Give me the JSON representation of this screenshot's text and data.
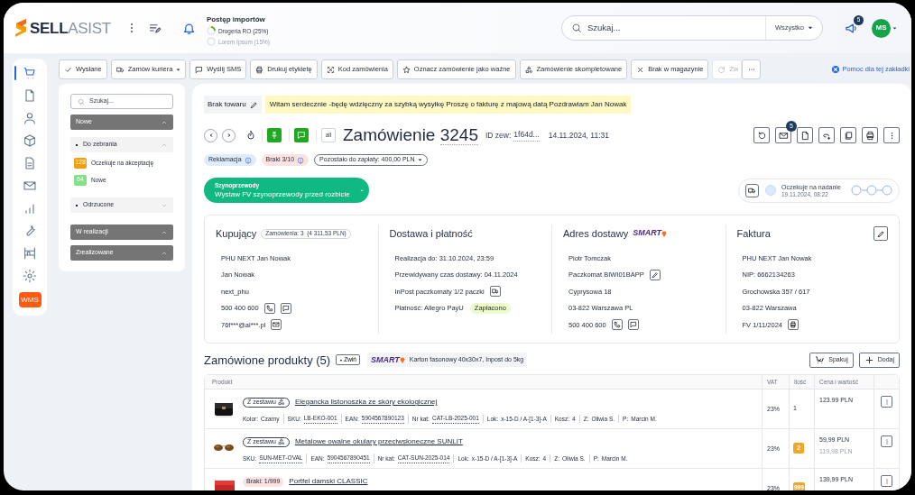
{
  "header": {
    "logo": {
      "bold": "SELL",
      "light": "ASIST"
    },
    "imports": {
      "title": "Postęp importów",
      "items": [
        {
          "label": "Drogeria RO (25%)",
          "level": 0.25,
          "faded": false
        },
        {
          "label": "Lorem Ipsum (15%)",
          "faded": true
        }
      ]
    },
    "search": {
      "placeholder": "Szukaj...",
      "scope": "Wszystko"
    },
    "notifications": "5",
    "avatar": "MS"
  },
  "nav": {
    "items": [
      {
        "selected": true
      },
      {
        "selected": false
      },
      {
        "selected": false
      },
      {
        "selected": false
      },
      {
        "selected": false
      },
      {
        "selected": false
      },
      {
        "selected": false
      },
      {
        "selected": false
      },
      {
        "selected": false
      },
      {
        "selected": false
      }
    ],
    "wms_button": "WMS"
  },
  "toolbar": {
    "actions": [
      {
        "label": "Wysłane",
        "dropdown": false,
        "disabled": false
      },
      {
        "label": "Zamów kuriera",
        "dropdown": true,
        "disabled": false
      },
      {
        "label": "Wyślij SMS",
        "dropdown": false,
        "disabled": false
      },
      {
        "label": "Drukuj etykietę",
        "dropdown": false,
        "disabled": false
      },
      {
        "label": "Kod zamówienia",
        "dropdown": false,
        "disabled": false
      },
      {
        "label": "Oznacz zamówienie jako ważne",
        "dropdown": false,
        "disabled": false
      },
      {
        "label": "Zamówienie skompletowane",
        "dropdown": false,
        "disabled": false
      },
      {
        "label": "Brak w magazynie",
        "dropdown": false,
        "disabled": false
      },
      {
        "label": "Zw",
        "dropdown": false,
        "disabled": true
      }
    ],
    "help_link": "Pomoc dla tej zakładki"
  },
  "filter": {
    "search_placeholder": "Szukaj...",
    "groups": [
      {
        "label": "Nowe",
        "expanded": true,
        "children": [
          {
            "label": "Do zebrania",
            "expanded": true,
            "statuses": [
              {
                "count": "128",
                "label": "Oczekuje na akceptację",
                "color": "#f59e0b"
              },
              {
                "count": "64",
                "label": "Nowe",
                "color": "#86e08a"
              }
            ]
          },
          {
            "label": "Odrzucone",
            "expanded": false
          }
        ]
      },
      {
        "label": "W realizacji",
        "expanded": true
      },
      {
        "label": "Zrealizowane",
        "expanded": true
      }
    ]
  },
  "order": {
    "status_tag": "Brak towaru",
    "note": "Witam serdecznie -będę wdzięczny za szybką wysyłkę Proszę o fakturę z majową datą Pozdrawiam Jan Nowak",
    "pinned": true,
    "has_chat": true,
    "channel": "all",
    "title": "Zamówienie",
    "number": "3245",
    "external_id_label": "ID zew:",
    "external_id": "1f64d...",
    "date": "14.11.2024, 11:31",
    "messages_count": "5",
    "badges": [
      {
        "label": "Reklamacja",
        "kind": "claim"
      },
      {
        "label": "Braki 3/10",
        "kind": "shortage"
      },
      {
        "label": "Pozostało do zapłaty: 400,00 PLN",
        "kind": "payment"
      }
    ],
    "action": {
      "caption": "Szynoprzewody",
      "label": "Wystaw FV szynoprzewody przed rozbicie"
    },
    "shipment": {
      "status": "Oczekuje na nadanie",
      "date": "19.11.2024, 08:22",
      "steps": [
        {
          "done": false
        },
        {
          "done": false
        },
        {
          "done": false
        }
      ]
    }
  },
  "details": [
    {
      "title": "Kupujący",
      "badge": "Zamówienia: 3  (4 311,53 PLN)",
      "lines": [
        {
          "text": "PHU NEXT Jan Nowak",
          "kind": "plain"
        },
        {
          "text": "Jan Nowak",
          "kind": "plain"
        },
        {
          "text": "next_phu",
          "kind": "plain"
        },
        {
          "text": "500 400 600",
          "kind": "phone"
        },
        {
          "text": "76f***@al***.pl",
          "kind": "email"
        }
      ]
    },
    {
      "title": "Dostawa i płatność",
      "lines": [
        {
          "text": "Realizacja do: 31.10.2024, 23:59",
          "kind": "plain"
        },
        {
          "text": "Przewidywany czas dostawy: 04.11.2024",
          "kind": "plain"
        },
        {
          "text": "InPost paczkomaty 1/2 paczki",
          "kind": "parcels"
        },
        {
          "text": "Płatność: Allegro PayU",
          "kind": "payment",
          "status": "Zapłacono"
        }
      ]
    },
    {
      "title": "Adres dostawy",
      "logo": "SMART",
      "lines": [
        {
          "text": "Piotr Tomczak",
          "kind": "plain"
        },
        {
          "text": "Paczkomat BIWI01BAPP",
          "kind": "locker"
        },
        {
          "text": "Cyprysowa 18",
          "kind": "plain"
        },
        {
          "text": "03-822 Warszawa PL",
          "kind": "plain"
        },
        {
          "text": "500 400 600",
          "kind": "phone"
        }
      ]
    },
    {
      "title": "Faktura",
      "editable": true,
      "lines": [
        {
          "text": "PHU NEXT Jan Nowak",
          "kind": "plain"
        },
        {
          "text": "NIP: 6662134263",
          "kind": "plain"
        },
        {
          "text": "Grochowska 357 / 617",
          "kind": "plain"
        },
        {
          "text": "03-822 Warszawa",
          "kind": "plain"
        },
        {
          "text": "FV 1/11/2024",
          "kind": "invoice"
        }
      ]
    }
  ],
  "products": {
    "title": "Zamówione produkty (5)",
    "collapse": "Zwiń",
    "carrier_logo": "SMART",
    "package": "Karton fasonowy 40x30x7, Inpost do 5kg",
    "buttons": [
      {
        "label": "Spakuj",
        "kind": "pack"
      },
      {
        "label": "Dodaj",
        "kind": "add"
      }
    ],
    "columns": [
      "Produkt",
      "VAT",
      "Ilość",
      "Cena i wartość"
    ],
    "rows": [
      {
        "image": {
          "kind": "picture"
        },
        "tag": {
          "kind": "set",
          "label": "Z zestawu"
        },
        "name": "Elegancka listonoszka ze skóry ekologicznej",
        "attributes": [
          {
            "label": "Kolor:",
            "value": "Czarny",
            "underlined": false
          },
          {
            "label": "SKU:",
            "value": "LB-EKO-001",
            "underlined": true
          },
          {
            "label": "EAN:",
            "value": "5904567890123",
            "underlined": true
          },
          {
            "label": "Nr kat:",
            "value": "CAT-LB-2025-001",
            "underlined": true
          },
          {
            "label": "Lok:",
            "value": "x-15-D / A-[1-3]-A",
            "underlined": false
          },
          {
            "label": "Kosz:",
            "value": "4",
            "underlined": false
          },
          {
            "label": "Z:",
            "value": "Oliwia S.",
            "underlined": false
          },
          {
            "label": "P:",
            "value": "Marcin M.",
            "underlined": false
          }
        ],
        "vat": "23%",
        "quantity": {
          "value": "1",
          "kind": "plain"
        },
        "price": "123.99 PLN"
      },
      {
        "image": {
          "kind": "picture"
        },
        "tag": {
          "kind": "set",
          "label": "Z zestawu"
        },
        "name": "Metalowe owalne okulary przeciwsłoneczne SUNLIT",
        "attributes": [
          {
            "label": "SKU:",
            "value": "SUN-MET-OVAL",
            "underlined": true
          },
          {
            "label": "EAN:",
            "value": "5904567890451",
            "underlined": true
          },
          {
            "label": "Nr kat:",
            "value": "CAT-SUN-2025-014",
            "underlined": true
          },
          {
            "label": "Lok:",
            "value": "x-15-D / A-[1-3]-A",
            "underlined": false
          },
          {
            "label": "Kosz:",
            "value": "4",
            "underlined": false
          },
          {
            "label": "Z:",
            "value": "Oliwia S.",
            "underlined": false
          },
          {
            "label": "P:",
            "value": "Marcin M.",
            "underlined": false
          }
        ],
        "vat": "23%",
        "quantity": {
          "value": "2",
          "kind": "highlight"
        },
        "price": "59,99 PLN",
        "total": "119,98 PLN"
      },
      {
        "image": {
          "kind": "picture"
        },
        "tag": {
          "kind": "shortage",
          "label": "Braki: 1/999"
        },
        "name": "Portfel damski CLASSIC",
        "attributes": [],
        "vat": "23%",
        "quantity": {
          "value": "999",
          "kind": "highlight"
        },
        "price": "139,99 PLN"
      }
    ]
  }
}
